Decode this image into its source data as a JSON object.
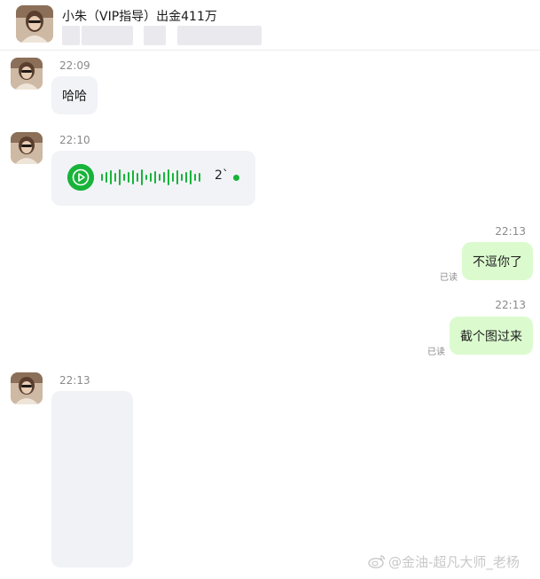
{
  "header": {
    "title": "小朱（VIP指导）出金411万"
  },
  "messages": [
    {
      "side": "left",
      "time": "22:09",
      "text": "哈哈"
    },
    {
      "side": "left",
      "time": "22:10",
      "voice": {
        "duration": "2`"
      }
    },
    {
      "side": "right",
      "time": "22:13",
      "text": "不逗你了",
      "status": "已读"
    },
    {
      "side": "right",
      "time": "22:13",
      "text": "截个图过来",
      "status": "已读"
    },
    {
      "side": "left",
      "time": "22:13",
      "image": true
    }
  ],
  "watermark": "@金油-超凡大师_老杨",
  "colors": {
    "accent_green": "#19b33a",
    "right_bubble": "#dbfbce",
    "left_bubble": "#f2f3f7"
  }
}
